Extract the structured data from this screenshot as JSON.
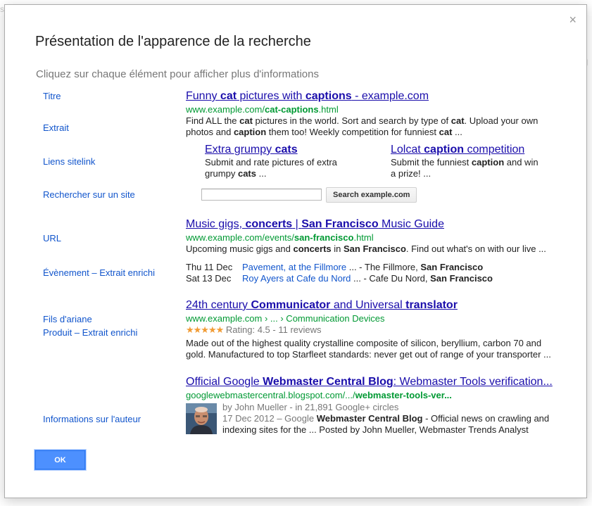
{
  "dialog": {
    "close_glyph": "×",
    "title": "Présentation de l'apparence de la recherche",
    "subtitle": "Cliquez sur chaque élément pour afficher plus d'informations",
    "ok_label": "OK"
  },
  "labels": {
    "titre": "Titre",
    "extrait": "Extrait",
    "sitelinks": "Liens sitelink",
    "site_search": "Rechercher sur un site",
    "url": "URL",
    "event": "Évènement – Extrait enrichi",
    "breadcrumbs": "Fils d'ariane",
    "product": "Produit – Extrait enrichi",
    "author": "Informations sur l'auteur"
  },
  "result1": {
    "title_a": "Funny ",
    "title_b": "cat",
    "title_c": " pictures with ",
    "title_d": "captions",
    "title_e": " - example.com",
    "url_a": "www.example.com/",
    "url_b": "cat-captions",
    "url_c": ".html",
    "snippet": {
      "s1": "Find ALL the ",
      "b1": "cat",
      "s2": " pictures in the world. Sort and search by type of ",
      "b2": "cat",
      "s3": ". Upload your own photos and ",
      "b3": "caption",
      "s4": " them too! Weekly competition for funniest ",
      "b4": "cat",
      "s5": " ..."
    },
    "sitelink1": {
      "title_a": "Extra grumpy ",
      "title_b": "cats",
      "desc_a": "Submit and rate pictures of extra grumpy ",
      "desc_b": "cats",
      "desc_c": " ..."
    },
    "sitelink2": {
      "title_a": "Lolcat ",
      "title_b": "caption",
      "title_c": " competition",
      "desc_a": "Submit the funniest ",
      "desc_b": "caption",
      "desc_c": " and win a prize!",
      "desc_d": " ..."
    },
    "search_placeholder": "",
    "search_button": "Search example.com"
  },
  "result2": {
    "title_a": "Music gigs, ",
    "title_b": "concerts",
    "title_c": " | ",
    "title_d": "San Francisco",
    "title_e": " Music Guide",
    "url_a": "www.example.com/events/",
    "url_b": "san-francisco",
    "url_c": ".html",
    "snippet": {
      "s1": "Upcoming music gigs and ",
      "b1": "concerts",
      "s2": " in ",
      "b2": "San Francisco",
      "s3": ". Find out what's on with our live ..."
    },
    "events": [
      {
        "date": "Thu 11 Dec",
        "name": "Pavement, at the Fillmore",
        "rest_a": " ... - The Fillmore, ",
        "rest_b": "San Francisco"
      },
      {
        "date": "Sat 13 Dec",
        "name": "Roy Ayers at Cafe du Nord",
        "rest_a": " ... - Cafe Du Nord, ",
        "rest_b": "San Francisco"
      }
    ]
  },
  "result3": {
    "title_a": "24th century ",
    "title_b": "Communicator",
    "title_c": " and Universal ",
    "title_d": "translator",
    "crumb": "www.example.com › ... › Communication Devices",
    "stars": "★★★★★",
    "rating_text": "Rating: 4.5 - 11 reviews",
    "snippet": "Made out of the highest quality crystalline composite of silicon, beryllium, carbon 70 and gold. Manufactured to top Starfleet standards: never get out of range of your transporter ..."
  },
  "result4": {
    "title_a": "Official Google ",
    "title_b": "Webmaster Central Blog",
    "title_c": ": Webmaster Tools verification...",
    "url_a": "googlewebmastercentral.blogspot.com/.../",
    "url_b": "webmaster-tools-ver...",
    "byline": "by John Mueller - in 21,891 Google+ circles",
    "line2_a": "17 Dec 2012 – Google ",
    "line2_b": "Webmaster Central Blog",
    "line2_c": " - Official news on crawling and",
    "line3": "indexing  sites for the ... Posted by John Mueller, Webmaster Trends Analyst"
  },
  "colors": {
    "link": "#1a0dab",
    "label": "#1155cc",
    "url": "#009933",
    "ok_button": "#4d90fe",
    "stars": "#f19c36"
  }
}
